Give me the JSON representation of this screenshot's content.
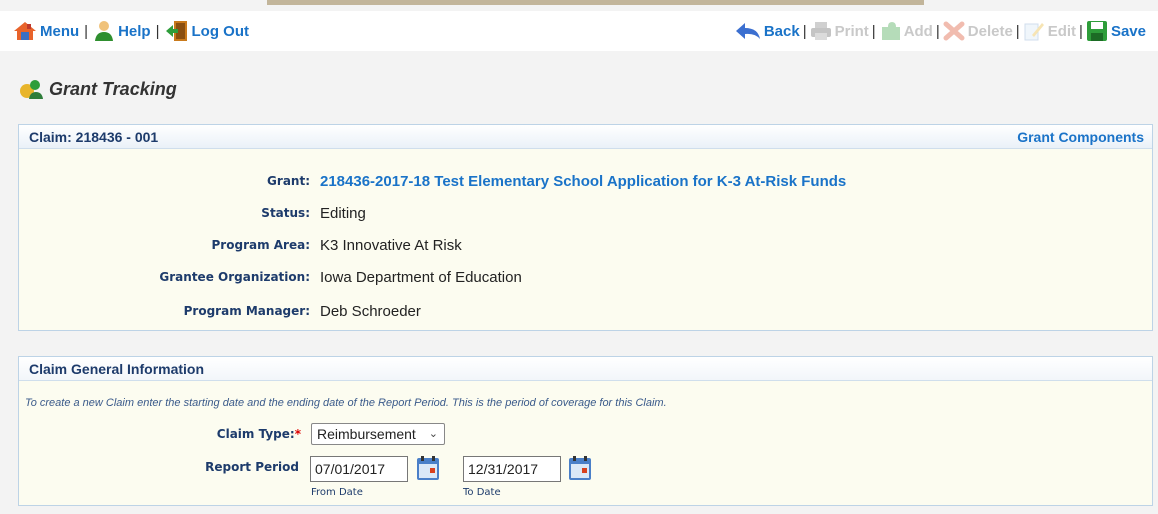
{
  "toolbar": {
    "menu": "Menu",
    "help": "Help",
    "logout": "Log Out",
    "back": "Back",
    "print": "Print",
    "add": "Add",
    "delete": "Delete",
    "edit": "Edit",
    "save": "Save",
    "sep": "|"
  },
  "page": {
    "title": "Grant Tracking"
  },
  "claim_panel": {
    "header": "Claim: 218436 - 001",
    "components_link": "Grant Components",
    "fields": {
      "grant_label": "Grant:",
      "grant_value": "218436-2017-18 Test Elementary School Application for K-3 At-Risk Funds",
      "status_label": "Status:",
      "status_value": "Editing",
      "program_area_label": "Program Area:",
      "program_area_value": "K3 Innovative At Risk",
      "grantee_label": "Grantee Organization:",
      "grantee_value": "Iowa Department of Education",
      "manager_label": "Program Manager:",
      "manager_value": "Deb Schroeder"
    }
  },
  "general_panel": {
    "header": "Claim General Information",
    "instruction": "To create a new Claim enter the starting date and the ending date of the Report Period. This is the period of coverage for this Claim.",
    "claim_type_label": "Claim Type:",
    "required_mark": "*",
    "claim_type_value": "Reimbursement",
    "report_period_label": "Report Period",
    "from_date": "07/01/2017",
    "from_label": "From Date",
    "to_date": "12/31/2017",
    "to_label": "To Date"
  },
  "colors": {
    "link": "#1a73c8",
    "label": "#1d3b6b",
    "panel_bg": "#fcfcf0",
    "required": "#dd0000"
  }
}
